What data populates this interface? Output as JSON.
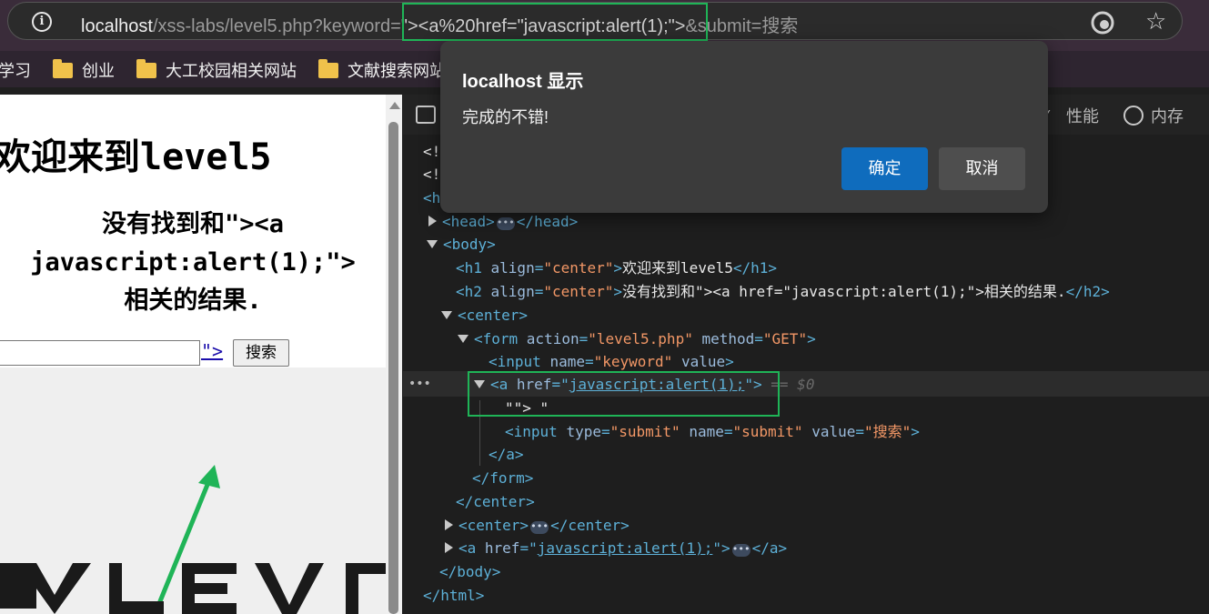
{
  "browser": {
    "url_host": "localhost",
    "url_path": "/xss-labs/level5.php?keyword=",
    "url_payload": "\"><a%20href=\"javascript:alert(1);\">",
    "url_rest": "&submit=搜索"
  },
  "bookmarks": [
    {
      "label": "学习"
    },
    {
      "label": "创业"
    },
    {
      "label": "大工校园相关网站"
    },
    {
      "label": "文献搜索网站"
    }
  ],
  "page": {
    "heading": "欢迎来到level5",
    "subheading_line1": "没有找到和\"><a",
    "subheading_line2": "javascript:alert(1);\">",
    "subheading_line3": "相关的结果.",
    "link_fragment": "\">",
    "search_button": "搜索",
    "logo_text": "LEVEL"
  },
  "devtools": {
    "tabs": {
      "perf": "性能",
      "memory": "内存"
    },
    "doctype1": "<!",
    "doctype2": "<!",
    "html_open": "<h",
    "l_head_open": "<head>",
    "l_head_close": "</head>",
    "l_body": "<body>",
    "l_h1_open": "<h1 ",
    "l_h1_attr": "align",
    "l_h1_val": "\"center\"",
    "l_h1_text": "欢迎来到level5",
    "l_h1_close": "</h1>",
    "l_h2_open": "<h2 ",
    "l_h2_attr": "align",
    "l_h2_val": "\"center\"",
    "l_h2_text": "没有找到和\"><a href=\"javascript:alert(1);\">相关的结果.",
    "l_h2_close": "</h2>",
    "l_center": "<center>",
    "l_form_open": "<form ",
    "l_form_a1": "action",
    "l_form_v1": "\"level5.php\"",
    "l_form_a2": "method",
    "l_form_v2": "\"GET\"",
    "l_input_open": "<input ",
    "l_input_a1": "name",
    "l_input_v1": "\"keyword\"",
    "l_input_a2": "value",
    "l_a_open": "<a ",
    "l_a_attr": "href",
    "l_a_val": "javascript:alert(1);",
    "eq0": "== $0",
    "l_text_node": "\"\"> \"",
    "l_submit_open": "<input ",
    "l_submit_a1": "type",
    "l_submit_v1": "\"submit\"",
    "l_submit_a2": "name",
    "l_submit_v2": "\"submit\"",
    "l_submit_a3": "value",
    "l_submit_v3": "\"搜索\"",
    "l_a_close": "</a>",
    "l_form_close": "</form>",
    "l_center_close": "</center>",
    "l_center2_open": "<center>",
    "l_center2_close": "</center>",
    "l_a2_open": "<a ",
    "l_a2_attr": "href",
    "l_a2_val": "javascript:alert(1);",
    "l_a2_close": "</a>",
    "l_body_close": "</body>",
    "l_html_close": "</html>"
  },
  "dialog": {
    "title": "localhost 显示",
    "message": "完成的不错!",
    "ok": "确定",
    "cancel": "取消"
  },
  "colors": {
    "highlight": "#1fb457",
    "ok_button": "#0f6cbd"
  }
}
